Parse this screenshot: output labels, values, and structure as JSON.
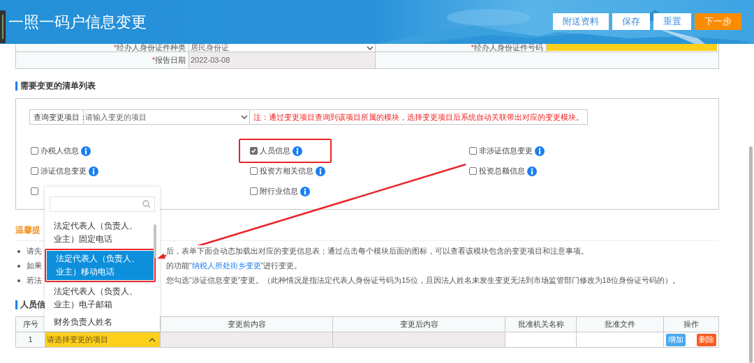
{
  "header": {
    "title": "一照一码户信息变更",
    "buttons": [
      {
        "label": "附送资料",
        "kind": "plain"
      },
      {
        "label": "保存",
        "kind": "plain"
      },
      {
        "label": "重置",
        "kind": "plain"
      },
      {
        "label": "下一步",
        "kind": "primary"
      }
    ]
  },
  "form": {
    "rows": [
      {
        "cells": [
          {
            "kind": "label",
            "text": "经办人身份证件种类",
            "required_mark": "*"
          },
          {
            "kind": "select",
            "text": "居民身份证"
          },
          {
            "kind": "label",
            "text": "经办人身份证件号码",
            "required_mark": "*"
          },
          {
            "kind": "required_input"
          }
        ]
      },
      {
        "cells": [
          {
            "kind": "label",
            "text": "报告日期",
            "required_mark": "*"
          },
          {
            "kind": "readonly",
            "text": "2022-03-08"
          },
          {
            "kind": "blank"
          }
        ]
      }
    ]
  },
  "checklist": {
    "heading": "需要变更的清单列表",
    "query_label": "查询变更项目：",
    "query_placeholder": "请输入变更的项目",
    "note": "注：通过变更项目查询到该项目所属的模块，选择变更项目后系统自动关联带出对应的变更模块。",
    "modules": [
      {
        "label": "办税人信息",
        "checked": false,
        "info": true
      },
      {
        "label": "人员信息",
        "checked": true,
        "info": true,
        "highlighted": true
      },
      {
        "label": "非涉证信息变更",
        "checked": false,
        "info": true
      },
      {
        "label": "涉证信息变更",
        "checked": false,
        "info": true
      },
      {
        "label": "投资方相关信息",
        "checked": false,
        "info": true
      },
      {
        "label": "投资总额信息",
        "checked": false,
        "info": true
      },
      {
        "checked": false,
        "info": false
      },
      {
        "label": "附行业信息",
        "checked": false,
        "info": true
      }
    ]
  },
  "tips": {
    "heading": "温馨提",
    "items": [
      {
        "start": "请先",
        "rest": [
          {
            "kind": "text",
            "text": "后，表单下面会动态加载出对应的变更信息表；通过点击每个模块后面的图标，可以查看该模块包含的变更项目和注意事项。"
          }
        ]
      },
      {
        "start": "如果",
        "rest": [
          {
            "kind": "text",
            "text": "的功能“"
          },
          {
            "kind": "link",
            "text": "纳税人所处街乡变更"
          },
          {
            "kind": "text",
            "text": "”进行变更。"
          }
        ]
      },
      {
        "start": "若法",
        "rest": [
          {
            "kind": "text",
            "text": "您勾选“涉证信息变更”变更。（此种情况是指法定代表人身份证号码为15位，且因法人姓名未发生变更无法到市场监管部门修改为18位身份证号码的）。"
          }
        ]
      }
    ]
  },
  "personnel": {
    "heading": "人员信",
    "columns": [
      "序号",
      "变更前内容",
      "变更后内容",
      "批准机关名称",
      "批准文件",
      "操作"
    ],
    "rows": [
      {
        "index": "1",
        "item": {
          "placeholder": "请选择变更的项目",
          "expanded": true
        },
        "buttons": [
          {
            "label": "增加",
            "kind": "add"
          },
          {
            "label": "删除",
            "kind": "delete"
          }
        ]
      }
    ]
  },
  "dropdown": {
    "options": [
      {
        "label": "法定代表人（负责人、业主）固定电话",
        "selected": false
      },
      {
        "label": "法定代表人（负责人、业主）移动电话",
        "selected": true,
        "highlighted": true
      },
      {
        "label": "法定代表人（负责人、业主）电子邮箱",
        "selected": false
      },
      {
        "label": "财务负责人姓名",
        "selected": false
      }
    ]
  }
}
